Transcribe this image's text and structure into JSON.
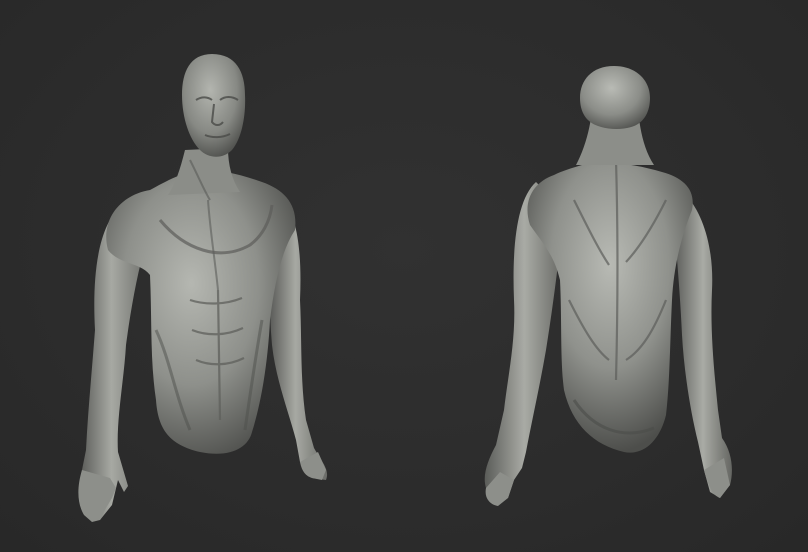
{
  "scene": {
    "background_color": "#2d2d2d",
    "material_color": "#8f918c",
    "shadow_color": "#3a3b39",
    "highlight_color": "#c8cac4"
  },
  "figures": [
    {
      "view": "front"
    },
    {
      "view": "back"
    }
  ]
}
